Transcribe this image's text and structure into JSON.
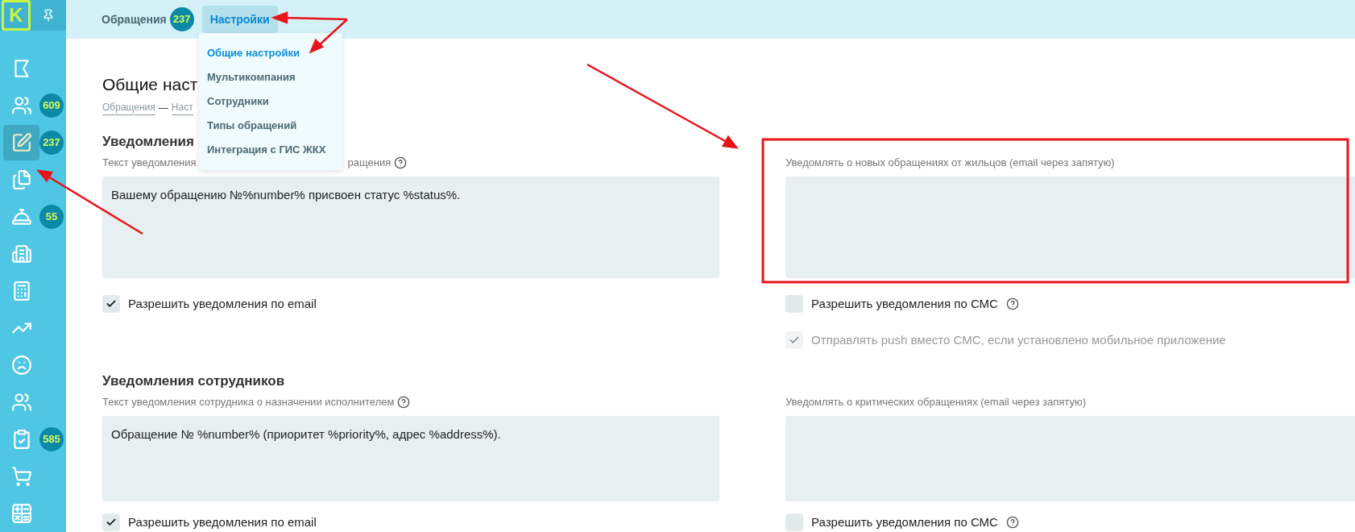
{
  "sidebar": {
    "logo": "K",
    "items": [
      {
        "selected": false
      },
      {
        "selected": false,
        "badge": "609"
      },
      {
        "selected": true,
        "badge": "237"
      },
      {
        "selected": false
      },
      {
        "selected": false,
        "badge": "55"
      },
      {
        "selected": false
      },
      {
        "selected": false
      },
      {
        "selected": false
      },
      {
        "selected": false
      },
      {
        "selected": false
      },
      {
        "selected": false,
        "badge": "585"
      },
      {
        "selected": false
      },
      {
        "selected": false
      }
    ]
  },
  "header": {
    "tabs": [
      {
        "label": "Обращения",
        "badge": "237",
        "selected": false
      },
      {
        "label": "Настройки",
        "selected": true
      }
    ]
  },
  "dropdown": {
    "items": [
      {
        "label": "Общие настройки",
        "selected": true
      },
      {
        "label": "Мультикомпания",
        "selected": false
      },
      {
        "label": "Сотрудники",
        "selected": false
      },
      {
        "label": "Типы обращений",
        "selected": false
      },
      {
        "label": "Интеграция с ГИС ЖКХ",
        "selected": false
      }
    ]
  },
  "page": {
    "title": "Общие наст",
    "breadcrumb": [
      {
        "label": "Обращения"
      },
      {
        "label": "Наст"
      }
    ],
    "breadcrumb_separator": "—"
  },
  "sections": [
    {
      "heading": "Уведомления",
      "left": {
        "label": "Текст уведомления",
        "label_tail": "ращения",
        "help": true,
        "value": "Вашему обращению №%number% присвоен статус %status%.",
        "checkboxes": [
          {
            "label": "Разрешить уведомления по email",
            "checked": true,
            "disabled": false,
            "help": false
          }
        ]
      },
      "right": {
        "label": "Уведомлять о новых обращениях от жильцов (email через запятую)",
        "help": false,
        "checkboxes": [
          {
            "label": "Разрешить уведомления по СМС",
            "checked": false,
            "disabled": false,
            "help": true
          },
          {
            "label": "Отправлять push вместо СМС, если установлено мобильное приложение",
            "checked": true,
            "disabled": true,
            "help": false
          }
        ]
      }
    },
    {
      "heading": "Уведомления сотрудников",
      "left": {
        "label": "Текст уведомления сотрудника о назначении исполнителем",
        "help": true,
        "value": "Обращение № %number% (приоритет %priority%, адрес %address%).",
        "checkboxes": [
          {
            "label": "Разрешить уведомления по email",
            "checked": true,
            "disabled": false,
            "help": false
          }
        ]
      },
      "right": {
        "label": "Уведомлять о критических обращениях (email через запятую)",
        "help": false,
        "checkboxes": [
          {
            "label": "Разрешить уведомления по СМС",
            "checked": false,
            "disabled": false,
            "help": true
          }
        ]
      }
    }
  ]
}
